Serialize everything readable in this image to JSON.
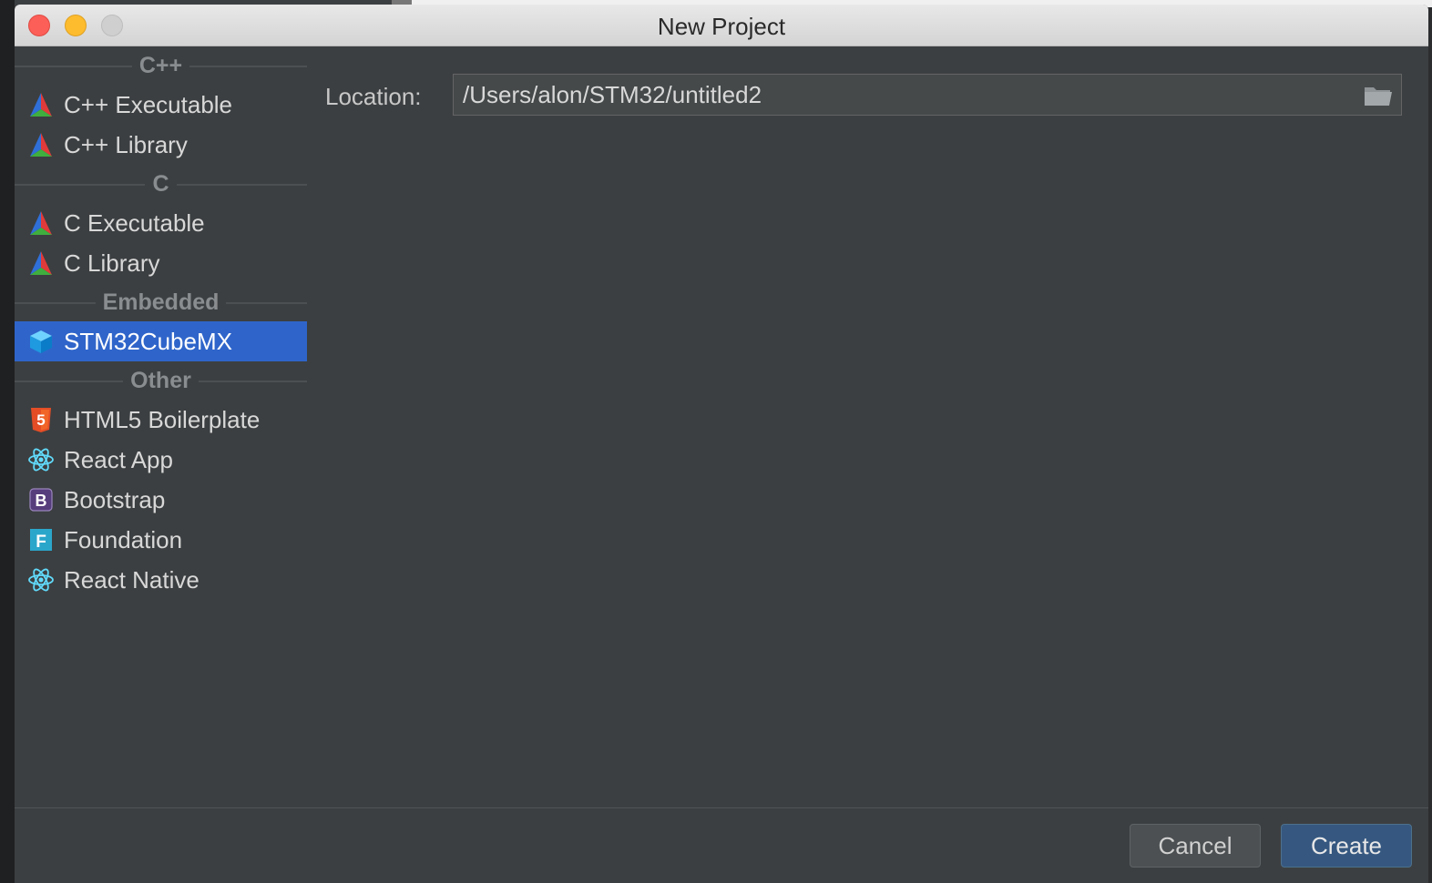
{
  "window": {
    "title": "New Project"
  },
  "sidebar": {
    "groups": [
      {
        "header": "C++",
        "items": [
          {
            "label": "C++ Executable",
            "icon": "cmake-icon"
          },
          {
            "label": "C++ Library",
            "icon": "cmake-icon"
          }
        ]
      },
      {
        "header": "C",
        "items": [
          {
            "label": "C Executable",
            "icon": "cmake-icon"
          },
          {
            "label": "C Library",
            "icon": "cmake-icon"
          }
        ]
      },
      {
        "header": "Embedded",
        "items": [
          {
            "label": "STM32CubeMX",
            "icon": "cube-icon",
            "selected": true
          }
        ]
      },
      {
        "header": "Other",
        "items": [
          {
            "label": "HTML5 Boilerplate",
            "icon": "html5-icon"
          },
          {
            "label": "React App",
            "icon": "react-icon"
          },
          {
            "label": "Bootstrap",
            "icon": "bootstrap-icon"
          },
          {
            "label": "Foundation",
            "icon": "foundation-icon"
          },
          {
            "label": "React Native",
            "icon": "react-icon"
          }
        ]
      }
    ]
  },
  "content": {
    "location_label": "Location:",
    "location_value": "/Users/alon/STM32/untitled2"
  },
  "footer": {
    "cancel_label": "Cancel",
    "create_label": "Create"
  },
  "colors": {
    "selection": "#2f65ca",
    "dialog_bg": "#3c3f41",
    "primary_button": "#365880"
  }
}
